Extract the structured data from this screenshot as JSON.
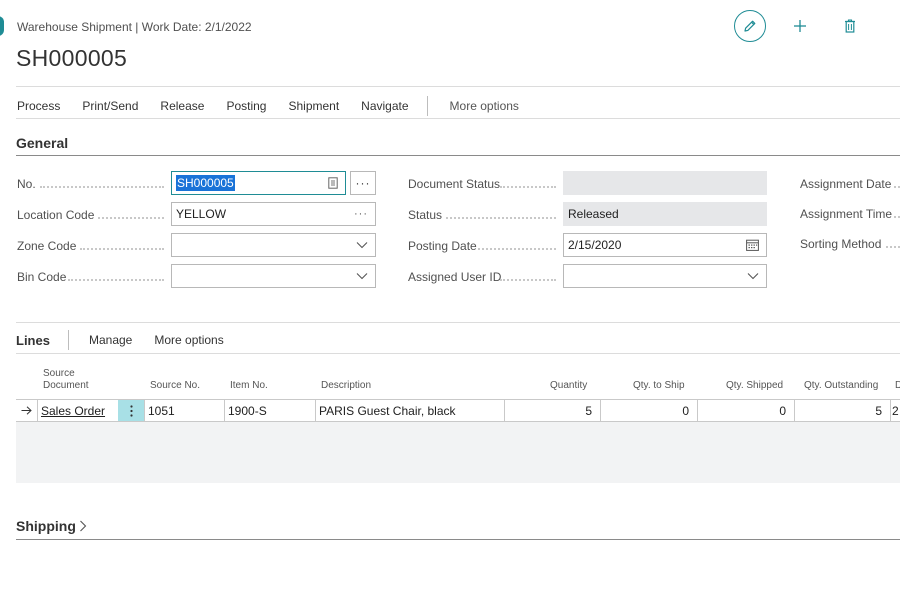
{
  "header": {
    "breadcrumb": "Warehouse Shipment | Work Date: 2/1/2022",
    "title": "SH000005"
  },
  "action_bar": {
    "items": [
      "Process",
      "Print/Send",
      "Release",
      "Posting",
      "Shipment",
      "Navigate"
    ],
    "more": "More options"
  },
  "general": {
    "title": "General",
    "no_label": "No.",
    "no_value": "SH000005",
    "location_label": "Location Code",
    "location_value": "YELLOW",
    "zone_label": "Zone Code",
    "zone_value": "",
    "bin_label": "Bin Code",
    "bin_value": "",
    "doc_status_label": "Document Status",
    "doc_status_value": "",
    "status_label": "Status",
    "status_value": "Released",
    "posting_date_label": "Posting Date",
    "posting_date_value": "2/15/2020",
    "assigned_user_label": "Assigned User ID",
    "assigned_user_value": "",
    "assignment_date_label": "Assignment Date",
    "assignment_time_label": "Assignment Time",
    "sorting_method_label": "Sorting Method",
    "ellipsis": "···"
  },
  "lines": {
    "title": "Lines",
    "manage": "Manage",
    "more": "More options",
    "columns": {
      "source_document_1": "Source",
      "source_document_2": "Document",
      "source_no": "Source No.",
      "item_no": "Item No.",
      "description": "Description",
      "quantity": "Quantity",
      "qty_to_ship": "Qty. to Ship",
      "qty_shipped": "Qty. Shipped",
      "qty_outstanding": "Qty. Outstanding",
      "cut_col": "D"
    },
    "rows": [
      {
        "source_document": "Sales Order",
        "source_no": "1051",
        "item_no": "1900-S",
        "description": "PARIS Guest Chair, black",
        "quantity": "5",
        "qty_to_ship": "0",
        "qty_shipped": "0",
        "qty_outstanding": "5",
        "cut_col": "2"
      }
    ]
  },
  "shipping": {
    "title": "Shipping"
  },
  "colors": {
    "accent": "#1f8c95",
    "selection": "#1a73d8",
    "readonly_bg": "#e6e7e9",
    "row_menu_bg": "#a8e0e6"
  }
}
